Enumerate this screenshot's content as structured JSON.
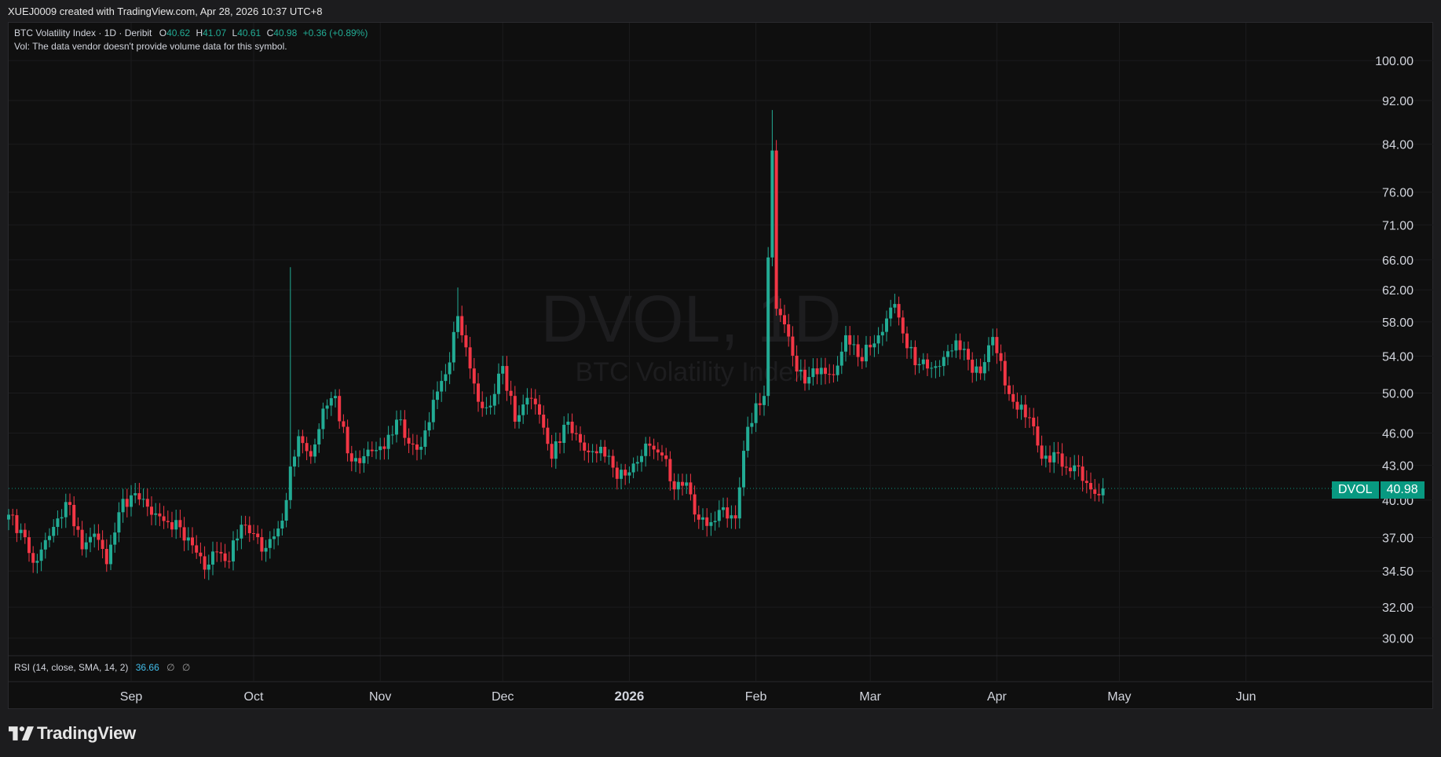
{
  "header": {
    "credit": "XUEJ0009 created with TradingView.com, Apr 28, 2026 10:37 UTC+8"
  },
  "legend": {
    "symbol": "BTC Volatility Index · 1D · Deribit",
    "o_label": "O",
    "o": "40.62",
    "h_label": "H",
    "h": "41.07",
    "l_label": "L",
    "l": "40.61",
    "c_label": "C",
    "c": "40.98",
    "change": "+0.36 (+0.89%)",
    "vol_note": "Vol: The data vendor doesn't provide volume data for this symbol."
  },
  "watermark": {
    "ticker": "DVOL, 1D",
    "name": "BTC Volatility Index"
  },
  "rsi": {
    "label": "RSI (14, close, SMA, 14, 2)",
    "value": "36.66",
    "sym1": "∅",
    "sym2": "∅"
  },
  "price_badge": {
    "symbol": "DVOL",
    "price": "40.98"
  },
  "brand": {
    "name": "TradingView"
  },
  "colors": {
    "up": "#22ab94",
    "down": "#f23645",
    "badge": "#089981",
    "rsi_value": "#42bdea",
    "background": "#0f0f0f"
  },
  "chart_data": {
    "type": "candlestick",
    "title": "BTC Volatility Index · 1D · Deribit",
    "scale": "log",
    "ylim": [
      29.3,
      102
    ],
    "y_ticks": [
      "100.00",
      "92.00",
      "84.00",
      "76.00",
      "71.00",
      "66.00",
      "62.00",
      "58.00",
      "54.00",
      "50.00",
      "46.00",
      "43.00",
      "40.00",
      "37.00",
      "34.50",
      "32.00",
      "30.00"
    ],
    "x_ticks": [
      "Sep",
      "Oct",
      "Nov",
      "Dec",
      "2026",
      "Feb",
      "Mar",
      "Apr",
      "May",
      "Jun"
    ],
    "last_price": 40.98,
    "start_date": "2025-08-02",
    "series": [
      {
        "date": "2025-08-02",
        "close": 38.8
      },
      {
        "date": "2025-08-05",
        "close": 37.6
      },
      {
        "date": "2025-08-08",
        "close": 35.1
      },
      {
        "date": "2025-08-11",
        "close": 36.8
      },
      {
        "date": "2025-08-14",
        "close": 38.5
      },
      {
        "date": "2025-08-17",
        "close": 39.6
      },
      {
        "date": "2025-08-20",
        "close": 36.1
      },
      {
        "date": "2025-08-23",
        "close": 37.3
      },
      {
        "date": "2025-08-26",
        "close": 35.0
      },
      {
        "date": "2025-08-29",
        "close": 39.0
      },
      {
        "date": "2025-09-01",
        "close": 40.4
      },
      {
        "date": "2025-09-04",
        "close": 40.1
      },
      {
        "date": "2025-09-07",
        "close": 38.9
      },
      {
        "date": "2025-09-10",
        "close": 38.2
      },
      {
        "date": "2025-09-13",
        "close": 37.8
      },
      {
        "date": "2025-09-16",
        "close": 36.4
      },
      {
        "date": "2025-09-19",
        "close": 34.6
      },
      {
        "date": "2025-09-22",
        "close": 35.9
      },
      {
        "date": "2025-09-25",
        "close": 35.2
      },
      {
        "date": "2025-09-28",
        "close": 38.0
      },
      {
        "date": "2025-10-01",
        "close": 37.3
      },
      {
        "date": "2025-10-04",
        "close": 36.2
      },
      {
        "date": "2025-10-07",
        "close": 37.7
      },
      {
        "date": "2025-10-09",
        "close": 40.0
      },
      {
        "date": "2025-10-10",
        "close": 42.9
      },
      {
        "date": "2025-10-12",
        "close": 45.7
      },
      {
        "date": "2025-10-15",
        "close": 43.8
      },
      {
        "date": "2025-10-18",
        "close": 48.4
      },
      {
        "date": "2025-10-21",
        "close": 49.7
      },
      {
        "date": "2025-10-24",
        "close": 44.1
      },
      {
        "date": "2025-10-27",
        "close": 43.2
      },
      {
        "date": "2025-10-30",
        "close": 44.3
      },
      {
        "date": "2025-11-02",
        "close": 44.5
      },
      {
        "date": "2025-11-05",
        "close": 47.3
      },
      {
        "date": "2025-11-08",
        "close": 45.0
      },
      {
        "date": "2025-11-11",
        "close": 44.7
      },
      {
        "date": "2025-11-14",
        "close": 49.3
      },
      {
        "date": "2025-11-17",
        "close": 52.0
      },
      {
        "date": "2025-11-20",
        "close": 58.7
      },
      {
        "date": "2025-11-22",
        "close": 55.0
      },
      {
        "date": "2025-11-25",
        "close": 49.1
      },
      {
        "date": "2025-11-28",
        "close": 48.7
      },
      {
        "date": "2025-12-01",
        "close": 52.9
      },
      {
        "date": "2025-12-04",
        "close": 47.1
      },
      {
        "date": "2025-12-07",
        "close": 49.5
      },
      {
        "date": "2025-12-10",
        "close": 47.8
      },
      {
        "date": "2025-12-13",
        "close": 43.6
      },
      {
        "date": "2025-12-16",
        "close": 46.8
      },
      {
        "date": "2025-12-19",
        "close": 45.9
      },
      {
        "date": "2025-12-22",
        "close": 44.2
      },
      {
        "date": "2025-12-25",
        "close": 44.7
      },
      {
        "date": "2025-12-28",
        "close": 42.8
      },
      {
        "date": "2025-12-31",
        "close": 42.1
      },
      {
        "date": "2026-01-03",
        "close": 43.3
      },
      {
        "date": "2026-01-06",
        "close": 44.8
      },
      {
        "date": "2026-01-09",
        "close": 43.9
      },
      {
        "date": "2026-01-12",
        "close": 40.9
      },
      {
        "date": "2026-01-15",
        "close": 41.5
      },
      {
        "date": "2026-01-18",
        "close": 38.4
      },
      {
        "date": "2026-01-21",
        "close": 38.2
      },
      {
        "date": "2026-01-24",
        "close": 39.4
      },
      {
        "date": "2026-01-27",
        "close": 38.5
      },
      {
        "date": "2026-01-30",
        "close": 46.6
      },
      {
        "date": "2026-02-03",
        "close": 49.7
      },
      {
        "date": "2026-02-05",
        "close": 82.9
      },
      {
        "date": "2026-02-06",
        "close": 59.6
      },
      {
        "date": "2026-02-08",
        "close": 57.7
      },
      {
        "date": "2026-02-11",
        "close": 52.3
      },
      {
        "date": "2026-02-14",
        "close": 51.7
      },
      {
        "date": "2026-02-17",
        "close": 52.7
      },
      {
        "date": "2026-02-20",
        "close": 51.9
      },
      {
        "date": "2026-02-23",
        "close": 56.4
      },
      {
        "date": "2026-02-26",
        "close": 53.9
      },
      {
        "date": "2026-03-01",
        "close": 55.0
      },
      {
        "date": "2026-03-04",
        "close": 56.8
      },
      {
        "date": "2026-03-07",
        "close": 60.2
      },
      {
        "date": "2026-03-10",
        "close": 54.9
      },
      {
        "date": "2026-03-13",
        "close": 53.1
      },
      {
        "date": "2026-03-16",
        "close": 52.7
      },
      {
        "date": "2026-03-19",
        "close": 53.9
      },
      {
        "date": "2026-03-22",
        "close": 55.8
      },
      {
        "date": "2026-03-25",
        "close": 53.6
      },
      {
        "date": "2026-03-28",
        "close": 52.1
      },
      {
        "date": "2026-03-31",
        "close": 56.2
      },
      {
        "date": "2026-04-03",
        "close": 50.8
      },
      {
        "date": "2026-04-06",
        "close": 48.3
      },
      {
        "date": "2026-04-09",
        "close": 47.5
      },
      {
        "date": "2026-04-12",
        "close": 43.6
      },
      {
        "date": "2026-04-15",
        "close": 44.2
      },
      {
        "date": "2026-04-18",
        "close": 42.8
      },
      {
        "date": "2026-04-21",
        "close": 42.9
      },
      {
        "date": "2026-04-24",
        "close": 40.9
      },
      {
        "date": "2026-04-26",
        "close": 40.4
      },
      {
        "date": "2026-04-27",
        "close": 40.98
      }
    ]
  }
}
